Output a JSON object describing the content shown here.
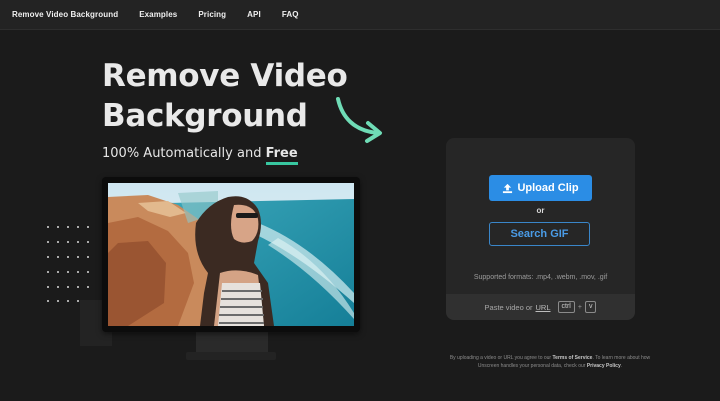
{
  "nav": {
    "items": [
      "Remove Video Background",
      "Examples",
      "Pricing",
      "API",
      "FAQ"
    ]
  },
  "hero": {
    "title_line1": "Remove Video",
    "title_line2": "Background",
    "subtitle_prefix": "100% Automatically and",
    "subtitle_highlight": "Free"
  },
  "upload": {
    "upload_label": "Upload Clip",
    "or_label": "or",
    "search_label": "Search GIF",
    "formats_text": "Supported formats: .mp4, .webm, .mov, .gif",
    "paste_prefix": "Paste video or",
    "paste_url": "URL",
    "key_ctrl": "ctrl",
    "key_plus": "+",
    "key_v": "v"
  },
  "legal": {
    "part1": "By uploading a video or URL you agree to our",
    "terms": "Terms of Service",
    "part2": ". To learn more about how Unscreen handles your personal data, check our",
    "privacy": "Privacy Policy",
    "part3": "."
  },
  "colors": {
    "accent_blue": "#2b8de5",
    "accent_green": "#38c7a0",
    "background": "#1b1b1b",
    "card": "#262626"
  },
  "icons": [
    "upload-icon",
    "curved-arrow-icon"
  ]
}
